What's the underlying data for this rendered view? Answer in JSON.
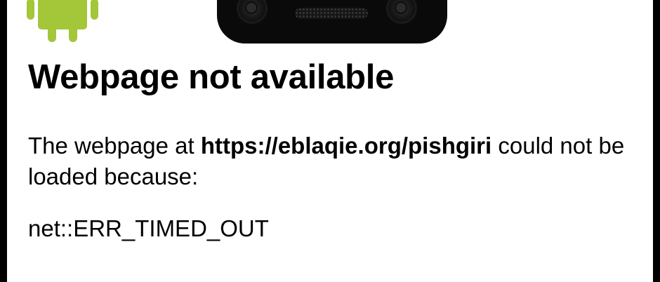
{
  "error_page": {
    "title": "Webpage not available",
    "message_prefix": "The webpage at ",
    "url": "https://eblaqie.org/pishgiri",
    "message_suffix": " could not be loaded because:",
    "error_code": "net::ERR_TIMED_OUT"
  },
  "colors": {
    "android_green": "#A4C639",
    "text": "#000000",
    "background": "#FFFFFF",
    "bezel": "#000000"
  },
  "icons": {
    "logo": "android-robot-icon",
    "camera": "front-camera-icon",
    "speaker": "earpiece-speaker-icon"
  }
}
